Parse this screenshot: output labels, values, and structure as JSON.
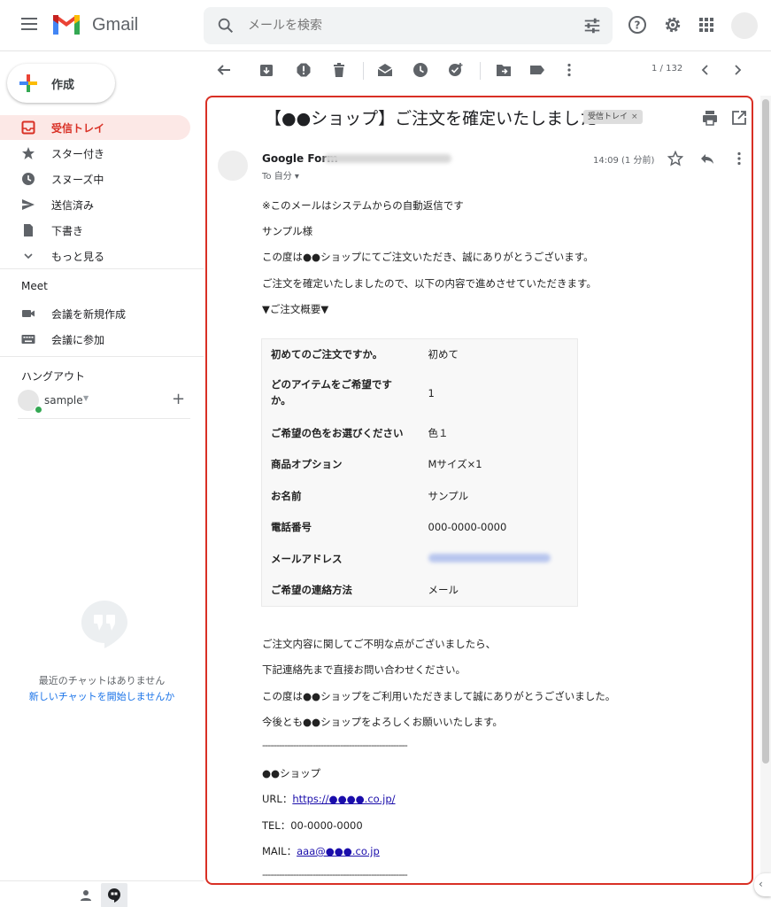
{
  "header": {
    "brand": "Gmail",
    "search_placeholder": "メールを検索"
  },
  "sidebar": {
    "compose_label": "作成",
    "items": [
      {
        "label": "受信トレイ",
        "icon": "inbox-icon",
        "active": true
      },
      {
        "label": "スター付き",
        "icon": "star-icon"
      },
      {
        "label": "スヌーズ中",
        "icon": "clock-icon"
      },
      {
        "label": "送信済み",
        "icon": "send-icon"
      },
      {
        "label": "下書き",
        "icon": "draft-icon"
      },
      {
        "label": "もっと見る",
        "icon": "chevron-down-icon"
      }
    ],
    "meet": {
      "title": "Meet",
      "items": [
        {
          "label": "会議を新規作成",
          "icon": "video-icon"
        },
        {
          "label": "会議に参加",
          "icon": "keyboard-icon"
        }
      ]
    },
    "hangouts": {
      "title": "ハングアウト",
      "user": "sample",
      "empty_text": "最近のチャットはありません",
      "empty_link": "新しいチャットを開始しませんか"
    }
  },
  "toolbar": {
    "pager": "1 / 132"
  },
  "message": {
    "subject": "【●●ショップ】ご注文を確定いたしました",
    "label_chip": "受信トレイ",
    "label_chip_close": "×",
    "sender_name": "Google Form",
    "to": "To 自分 ▾",
    "time": "14:09 (1 分前)",
    "body_top": [
      "※このメールはシステムからの自動返信です",
      "サンプル様",
      "この度は●●ショップにてご注文いただき、誠にありがとうございます。",
      "ご注文を確定いたしましたので、以下の内容で進めさせていただきます。",
      "▼ご注文概要▼"
    ],
    "summary": [
      {
        "key": "初めてのご注文ですか。",
        "value": "初めて"
      },
      {
        "key": "どのアイテムをご希望ですか。",
        "value": "1"
      },
      {
        "key": "ご希望の色をお選びください",
        "value": "色１"
      },
      {
        "key": "商品オプション",
        "value": "Mサイズ×1"
      },
      {
        "key": "お名前",
        "value": "サンプル"
      },
      {
        "key": "電話番号",
        "value": "000-0000-0000"
      },
      {
        "key": "メールアドレス",
        "value": ""
      },
      {
        "key": "ご希望の連絡方法",
        "value": "メール"
      }
    ],
    "body_bottom": [
      "ご注文内容に関してご不明な点がございましたら、",
      "下記連絡先まで直接お問い合わせください。",
      "この度は●●ショップをご利用いただきまして誠にありがとうございました。",
      "今後とも●●ショップをよろしくお願いいたします。"
    ],
    "separator": "----------------------------------------------------",
    "shop_name": "●●ショップ",
    "url_label": "URL：",
    "url_link": "https://●●●●.co.jp/",
    "tel": "TEL：00-0000-0000",
    "mail_label": "MAIL：",
    "mail_link": "aaa@●●●.co.jp"
  },
  "colors": {
    "accent": "#d93025",
    "active_bg": "#fce8e6",
    "link": "#1a73e8"
  }
}
